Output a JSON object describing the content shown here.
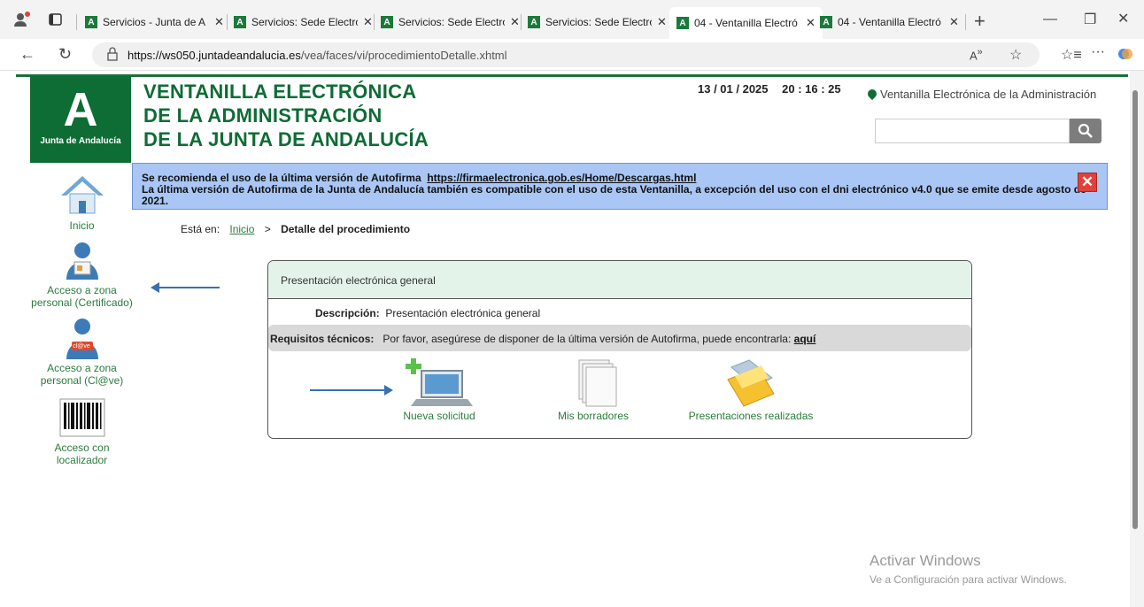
{
  "browser": {
    "tabs": [
      {
        "title": "Servicios - Junta de A"
      },
      {
        "title": "Servicios: Sede Electró"
      },
      {
        "title": "Servicios: Sede Electró"
      },
      {
        "title": "Servicios: Sede Electró"
      },
      {
        "title": "04 - Ventanilla Electró"
      },
      {
        "title": "04 - Ventanilla Electró"
      }
    ],
    "new_tab": "+",
    "url_host": "https://ws050.juntadeandalucia.es",
    "url_path": "/vea/faces/vi/procedimientoDetalle.xhtml"
  },
  "header": {
    "logo_letter": "A",
    "logo_text": "Junta de Andalucía",
    "title_line1": "VENTANILLA ELECTRÓNICA",
    "title_line2": "DE LA ADMINISTRACIÓN",
    "title_line3": "DE LA JUNTA DE ANDALUCÍA",
    "date": "13 / 01 / 2025",
    "time": "20 : 16 : 25",
    "location_link": "Ventanilla Electrónica de la Administración",
    "search_value": ""
  },
  "notice": {
    "line1_text": "Se recomienda el uso de la última versión de Autofirma",
    "line1_link": "https://firmaelectronica.gob.es/Home/Descargas.html",
    "line2_text": "La última versión de Autofirma de la Junta de Andalucía también es compatible con el uso de esta Ventanilla, a excepción del uso con el dni electrónico v4.0 que se emite desde agosto de 2021."
  },
  "sidebar": {
    "items": [
      {
        "label": "Inicio"
      },
      {
        "label_l1": "Acceso a zona",
        "label_l2": "personal (Certificado)"
      },
      {
        "label_l1": "Acceso a zona",
        "label_l2": "personal (Cl@ve)"
      },
      {
        "label_l1": "Acceso con",
        "label_l2": "localizador"
      }
    ],
    "clave_badge": "cl@ve"
  },
  "breadcrumb": {
    "prefix": "Está en:",
    "home": "Inicio",
    "sep": ">",
    "current": "Detalle del procedimiento"
  },
  "procedure": {
    "header": "Presentación electrónica general",
    "description_label": "Descripción:",
    "description_value": "Presentación electrónica general",
    "requirements_label": "Requisitos técnicos:",
    "requirements_text": "Por favor, asegúrese de disponer de la última versión de Autofirma, puede encontrarla:",
    "requirements_link": "aquí",
    "actions": [
      {
        "label": "Nueva solicitud",
        "icon": "new-request-laptop-icon"
      },
      {
        "label": "Mis borradores",
        "icon": "drafts-documents-icon"
      },
      {
        "label": "Presentaciones realizadas",
        "icon": "folder-icon"
      }
    ]
  },
  "watermark": {
    "line1": "Activar Windows",
    "line2": "Ve a Configuración para activar Windows."
  },
  "colors": {
    "brand_green": "#0e6c35",
    "notice_blue": "#a9c6f5",
    "arrow_blue": "#3b6fb1"
  }
}
